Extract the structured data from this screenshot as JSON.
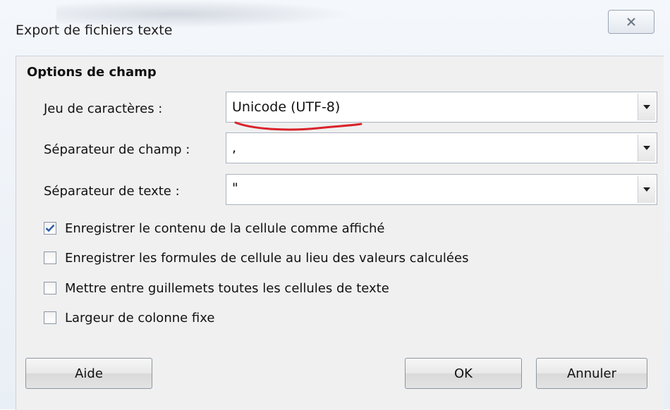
{
  "window": {
    "title": "Export de fichiers texte"
  },
  "section": {
    "title": "Options de champ"
  },
  "fields": [
    {
      "label": "Jeu de caractères :",
      "value": "Unicode (UTF-8)"
    },
    {
      "label": "Séparateur de champ :",
      "value": ","
    },
    {
      "label": "Séparateur de texte :",
      "value": "\""
    }
  ],
  "checkboxes": [
    {
      "label": "Enregistrer le contenu de la cellule comme affiché",
      "checked": true
    },
    {
      "label": "Enregistrer les formules de cellule au lieu des valeurs calculées",
      "checked": false
    },
    {
      "label": "Mettre entre guillemets toutes les cellules de texte",
      "checked": false
    },
    {
      "label": "Largeur de colonne fixe",
      "checked": false
    }
  ],
  "buttons": {
    "help": "Aide",
    "ok": "OK",
    "cancel": "Annuler"
  },
  "icons": {
    "close": "close-icon",
    "dropdown": "chevron-down-icon",
    "check": "checkmark-icon"
  },
  "colors": {
    "annotation": "#d9232a",
    "check": "#2a5aa8"
  }
}
